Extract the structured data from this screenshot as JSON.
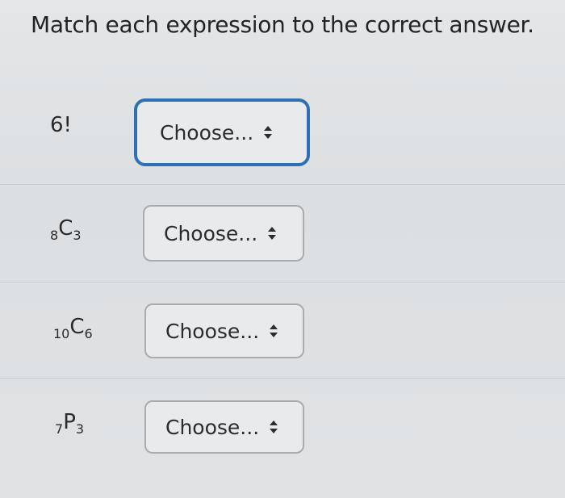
{
  "prompt": "Match each expression to the correct answer.",
  "rows": [
    {
      "expression": {
        "pre": "",
        "main": "6!",
        "sub": ""
      },
      "select": {
        "value": "Choose...",
        "icon": "up-down-arrows-icon"
      }
    },
    {
      "expression": {
        "pre": "8",
        "main": "C",
        "sub": "3"
      },
      "select": {
        "value": "Choose...",
        "icon": "up-down-arrows-icon"
      }
    },
    {
      "expression": {
        "pre": "10",
        "main": "C",
        "sub": "6"
      },
      "select": {
        "value": "Choose...",
        "icon": "up-down-arrows-icon"
      }
    },
    {
      "expression": {
        "pre": "7",
        "main": "P",
        "sub": "3"
      },
      "select": {
        "value": "Choose...",
        "icon": "up-down-arrows-icon"
      }
    }
  ],
  "colors": {
    "focus_border": "#2f6fb3",
    "select_border": "#a9abad",
    "background": "#dfe1e3"
  }
}
